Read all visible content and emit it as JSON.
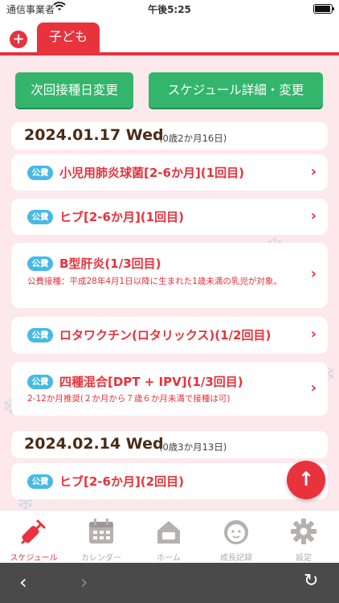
{
  "status_bar": {
    "carrier": "通信事業者",
    "time": "午後5:25"
  },
  "header": {
    "add_icon": "plus-circle-icon",
    "child_tab": "子ども"
  },
  "actions": {
    "next_date_button": "次回接種日変更",
    "schedule_button": "スケジュール詳細・変更"
  },
  "groups": [
    {
      "date": "2024.01.17 Wed",
      "age": "(0歳2か月16日)",
      "items": [
        {
          "badge": "公費",
          "title": "小児用肺炎球菌[2-6か月](1回目)",
          "note": ""
        },
        {
          "badge": "公費",
          "title": "ヒブ[2-6か月](1回目)",
          "note": ""
        },
        {
          "badge": "公費",
          "title": "B型肝炎(1/3回目)",
          "note": "公費接種：平成28年4月1日以降に生まれた1歳未満の乳児が対象。"
        },
        {
          "badge": "公費",
          "title": "ロタワクチン(ロタリックス)(1/2回目)",
          "note": ""
        },
        {
          "badge": "公費",
          "title": "四種混合[DPT + IPV](1/3回目)",
          "note": "2-12か月推奨(２か月から７歳６か月未満で接種は可)"
        }
      ]
    },
    {
      "date": "2024.02.14 Wed",
      "age": "(0歳3か月13日)",
      "items": [
        {
          "badge": "公費",
          "title": "ヒブ[2-6か月](2回目)",
          "note": ""
        }
      ]
    }
  ],
  "fab": {
    "icon": "arrow-up-icon"
  },
  "bottom_nav": [
    {
      "label": "スケジュール",
      "icon": "syringe-icon",
      "active": true
    },
    {
      "label": "カレンダー",
      "icon": "calendar-icon",
      "active": false
    },
    {
      "label": "ホーム",
      "icon": "home-icon",
      "active": false
    },
    {
      "label": "成長記録",
      "icon": "baby-face-icon",
      "active": false
    },
    {
      "label": "設定",
      "icon": "gear-icon",
      "active": false
    }
  ],
  "browser_bar": {
    "back_icon": "chevron-left-icon",
    "forward_icon": "chevron-right-icon",
    "reload_icon": "reload-icon"
  },
  "colors": {
    "accent": "#e8323c",
    "green": "#33b66c",
    "badge": "#47b9e6",
    "background": "#fbe6ea"
  }
}
